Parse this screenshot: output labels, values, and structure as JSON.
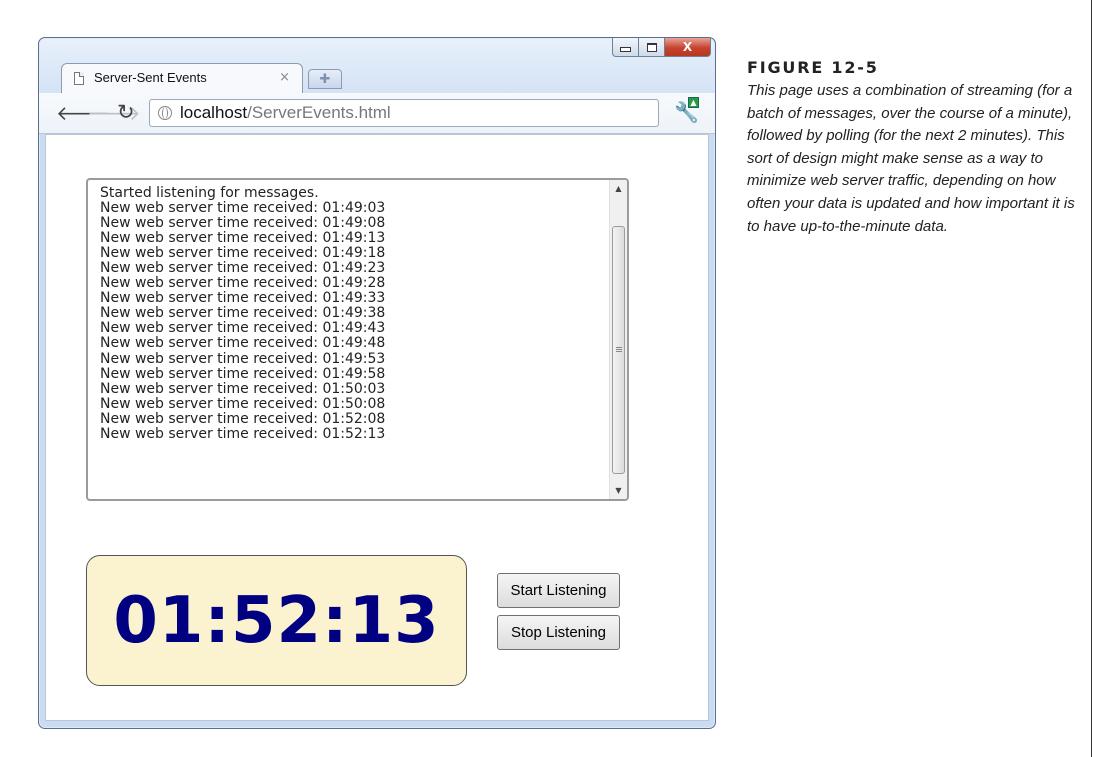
{
  "browser": {
    "tab_title": "Server-Sent Events",
    "tab_close": "×",
    "url_host": "localhost",
    "url_path": "/ServerEvents.html"
  },
  "messages": [
    "Started listening for messages.",
    "New web server time received: 01:49:03",
    "New web server time received: 01:49:08",
    "New web server time received: 01:49:13",
    "New web server time received: 01:49:18",
    "New web server time received: 01:49:23",
    "New web server time received: 01:49:28",
    "New web server time received: 01:49:33",
    "New web server time received: 01:49:38",
    "New web server time received: 01:49:43",
    "New web server time received: 01:49:48",
    "New web server time received: 01:49:53",
    "New web server time received: 01:49:58",
    "New web server time received: 01:50:03",
    "New web server time received: 01:50:08",
    "New web server time received: 01:52:08",
    "New web server time received: 01:52:13"
  ],
  "clock": {
    "time": "01:52:13",
    "color": "#000080",
    "background": "#fbf3cf"
  },
  "buttons": {
    "start": "Start Listening",
    "stop": "Stop Listening"
  },
  "figure": {
    "label": "FIGURE 12-5",
    "caption": "This page uses a combination of streaming (for a batch of messages, over the course of a minute), followed by polling (for the next 2 minutes). This sort of design might make sense as a way to minimize web server traffic, depending on how often your data is updated and how important it is to have up-to-the-minute data."
  }
}
